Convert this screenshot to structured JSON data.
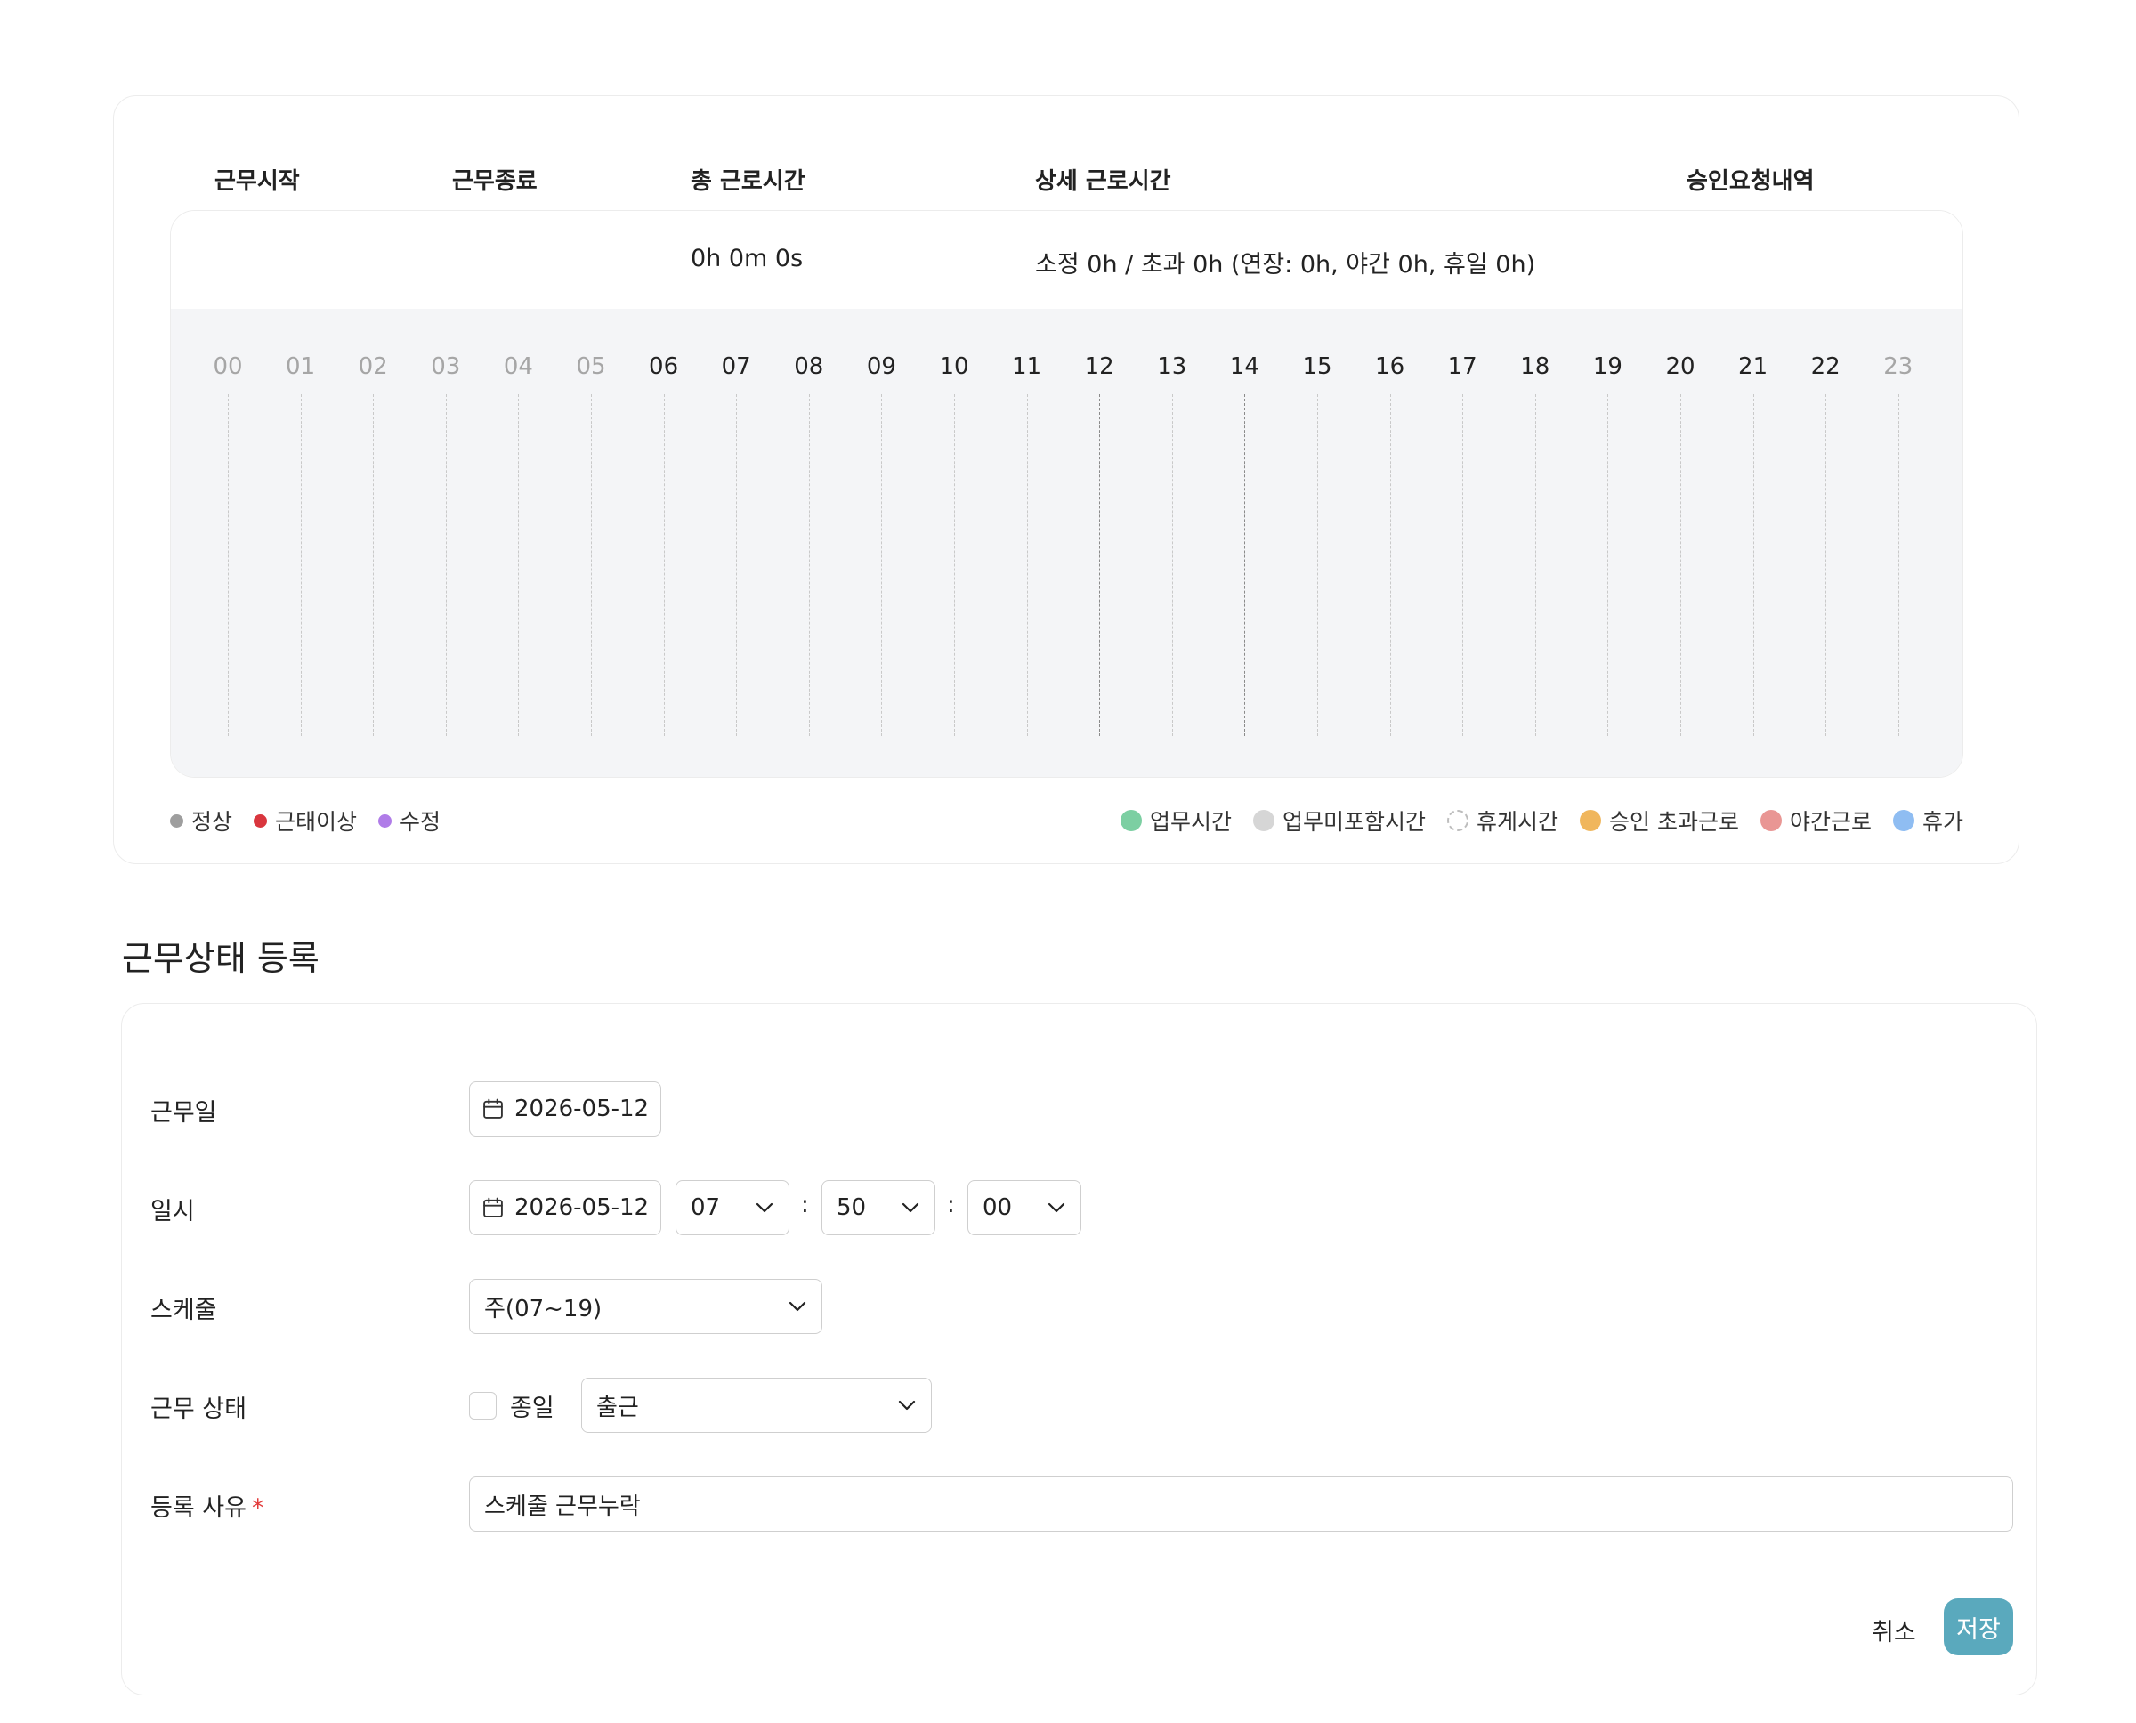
{
  "timeline": {
    "headers": {
      "start": "근무시작",
      "end": "근무종료",
      "total": "총 근로시간",
      "detail": "상세 근로시간",
      "approval": "승인요청내역"
    },
    "total_value": "0h 0m 0s",
    "detail_value": "소정 0h / 초과 0h (연장: 0h, 야간 0h, 휴일 0h)",
    "hours": [
      "00",
      "01",
      "02",
      "03",
      "04",
      "05",
      "06",
      "07",
      "08",
      "09",
      "10",
      "11",
      "12",
      "13",
      "14",
      "15",
      "16",
      "17",
      "18",
      "19",
      "20",
      "21",
      "22",
      "23"
    ],
    "legend_left": [
      {
        "label": "정상",
        "color": "#9e9e9e"
      },
      {
        "label": "근태이상",
        "color": "#d9363e"
      },
      {
        "label": "수정",
        "color": "#b07ce8"
      }
    ],
    "legend_right": [
      {
        "label": "업무시간",
        "color": "#7ccfa2"
      },
      {
        "label": "업무미포함시간",
        "color": "#d6d6d6"
      },
      {
        "label": "휴게시간",
        "color": "dashed"
      },
      {
        "label": "승인 초과근로",
        "color": "#f0b65c"
      },
      {
        "label": "야간근로",
        "color": "#e99694"
      },
      {
        "label": "휴가",
        "color": "#8fbdf2"
      }
    ]
  },
  "section_title": "근무상태 등록",
  "form": {
    "work_date": {
      "label": "근무일",
      "value": "2026-05-12"
    },
    "datetime": {
      "label": "일시",
      "date": "2026-05-12",
      "hour": "07",
      "minute": "50",
      "second": "00",
      "sep": ":"
    },
    "schedule": {
      "label": "스케줄",
      "value": "주(07~19)"
    },
    "status": {
      "label": "근무 상태",
      "allday_label": "종일",
      "value": "출근"
    },
    "reason": {
      "label": "등록 사유",
      "required_mark": "*",
      "value": "스케줄 근무누락"
    },
    "cancel_label": "취소",
    "save_label": "저장"
  }
}
